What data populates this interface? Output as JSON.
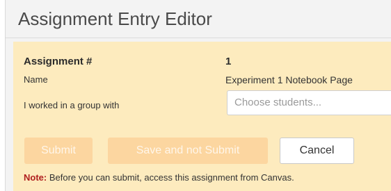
{
  "dialog": {
    "title": "Assignment Entry Editor"
  },
  "form": {
    "assignment_label": "Assignment #",
    "assignment_value": "1",
    "name_label": "Name",
    "name_value": "Experiment 1 Notebook Page",
    "group_label": "I worked in a group with",
    "group_placeholder": "Choose students..."
  },
  "buttons": {
    "submit": "Submit",
    "save_not_submit": "Save and not Submit",
    "cancel": "Cancel"
  },
  "note": {
    "prefix": "Note:",
    "text": " Before you can submit, access this assignment from Canvas."
  },
  "colors": {
    "panel_bg": "#fdebbe",
    "disabled_button_bg": "#fcd6a0",
    "note_prefix": "#b01e1e"
  }
}
